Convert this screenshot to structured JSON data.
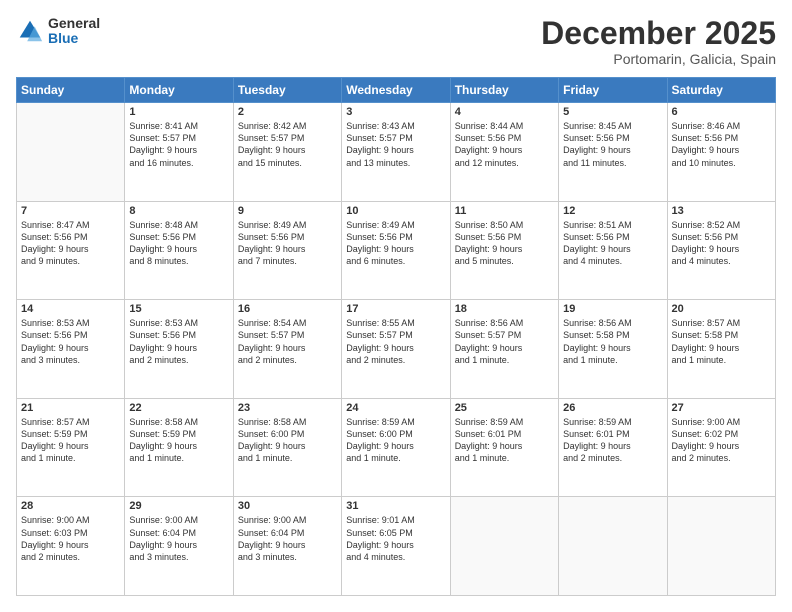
{
  "logo": {
    "general": "General",
    "blue": "Blue"
  },
  "title": "December 2025",
  "location": "Portomarin, Galicia, Spain",
  "weekdays": [
    "Sunday",
    "Monday",
    "Tuesday",
    "Wednesday",
    "Thursday",
    "Friday",
    "Saturday"
  ],
  "weeks": [
    [
      {
        "day": "",
        "info": ""
      },
      {
        "day": "1",
        "info": "Sunrise: 8:41 AM\nSunset: 5:57 PM\nDaylight: 9 hours\nand 16 minutes."
      },
      {
        "day": "2",
        "info": "Sunrise: 8:42 AM\nSunset: 5:57 PM\nDaylight: 9 hours\nand 15 minutes."
      },
      {
        "day": "3",
        "info": "Sunrise: 8:43 AM\nSunset: 5:57 PM\nDaylight: 9 hours\nand 13 minutes."
      },
      {
        "day": "4",
        "info": "Sunrise: 8:44 AM\nSunset: 5:56 PM\nDaylight: 9 hours\nand 12 minutes."
      },
      {
        "day": "5",
        "info": "Sunrise: 8:45 AM\nSunset: 5:56 PM\nDaylight: 9 hours\nand 11 minutes."
      },
      {
        "day": "6",
        "info": "Sunrise: 8:46 AM\nSunset: 5:56 PM\nDaylight: 9 hours\nand 10 minutes."
      }
    ],
    [
      {
        "day": "7",
        "info": "Sunrise: 8:47 AM\nSunset: 5:56 PM\nDaylight: 9 hours\nand 9 minutes."
      },
      {
        "day": "8",
        "info": "Sunrise: 8:48 AM\nSunset: 5:56 PM\nDaylight: 9 hours\nand 8 minutes."
      },
      {
        "day": "9",
        "info": "Sunrise: 8:49 AM\nSunset: 5:56 PM\nDaylight: 9 hours\nand 7 minutes."
      },
      {
        "day": "10",
        "info": "Sunrise: 8:49 AM\nSunset: 5:56 PM\nDaylight: 9 hours\nand 6 minutes."
      },
      {
        "day": "11",
        "info": "Sunrise: 8:50 AM\nSunset: 5:56 PM\nDaylight: 9 hours\nand 5 minutes."
      },
      {
        "day": "12",
        "info": "Sunrise: 8:51 AM\nSunset: 5:56 PM\nDaylight: 9 hours\nand 4 minutes."
      },
      {
        "day": "13",
        "info": "Sunrise: 8:52 AM\nSunset: 5:56 PM\nDaylight: 9 hours\nand 4 minutes."
      }
    ],
    [
      {
        "day": "14",
        "info": "Sunrise: 8:53 AM\nSunset: 5:56 PM\nDaylight: 9 hours\nand 3 minutes."
      },
      {
        "day": "15",
        "info": "Sunrise: 8:53 AM\nSunset: 5:56 PM\nDaylight: 9 hours\nand 2 minutes."
      },
      {
        "day": "16",
        "info": "Sunrise: 8:54 AM\nSunset: 5:57 PM\nDaylight: 9 hours\nand 2 minutes."
      },
      {
        "day": "17",
        "info": "Sunrise: 8:55 AM\nSunset: 5:57 PM\nDaylight: 9 hours\nand 2 minutes."
      },
      {
        "day": "18",
        "info": "Sunrise: 8:56 AM\nSunset: 5:57 PM\nDaylight: 9 hours\nand 1 minute."
      },
      {
        "day": "19",
        "info": "Sunrise: 8:56 AM\nSunset: 5:58 PM\nDaylight: 9 hours\nand 1 minute."
      },
      {
        "day": "20",
        "info": "Sunrise: 8:57 AM\nSunset: 5:58 PM\nDaylight: 9 hours\nand 1 minute."
      }
    ],
    [
      {
        "day": "21",
        "info": "Sunrise: 8:57 AM\nSunset: 5:59 PM\nDaylight: 9 hours\nand 1 minute."
      },
      {
        "day": "22",
        "info": "Sunrise: 8:58 AM\nSunset: 5:59 PM\nDaylight: 9 hours\nand 1 minute."
      },
      {
        "day": "23",
        "info": "Sunrise: 8:58 AM\nSunset: 6:00 PM\nDaylight: 9 hours\nand 1 minute."
      },
      {
        "day": "24",
        "info": "Sunrise: 8:59 AM\nSunset: 6:00 PM\nDaylight: 9 hours\nand 1 minute."
      },
      {
        "day": "25",
        "info": "Sunrise: 8:59 AM\nSunset: 6:01 PM\nDaylight: 9 hours\nand 1 minute."
      },
      {
        "day": "26",
        "info": "Sunrise: 8:59 AM\nSunset: 6:01 PM\nDaylight: 9 hours\nand 2 minutes."
      },
      {
        "day": "27",
        "info": "Sunrise: 9:00 AM\nSunset: 6:02 PM\nDaylight: 9 hours\nand 2 minutes."
      }
    ],
    [
      {
        "day": "28",
        "info": "Sunrise: 9:00 AM\nSunset: 6:03 PM\nDaylight: 9 hours\nand 2 minutes."
      },
      {
        "day": "29",
        "info": "Sunrise: 9:00 AM\nSunset: 6:04 PM\nDaylight: 9 hours\nand 3 minutes."
      },
      {
        "day": "30",
        "info": "Sunrise: 9:00 AM\nSunset: 6:04 PM\nDaylight: 9 hours\nand 3 minutes."
      },
      {
        "day": "31",
        "info": "Sunrise: 9:01 AM\nSunset: 6:05 PM\nDaylight: 9 hours\nand 4 minutes."
      },
      {
        "day": "",
        "info": ""
      },
      {
        "day": "",
        "info": ""
      },
      {
        "day": "",
        "info": ""
      }
    ]
  ]
}
